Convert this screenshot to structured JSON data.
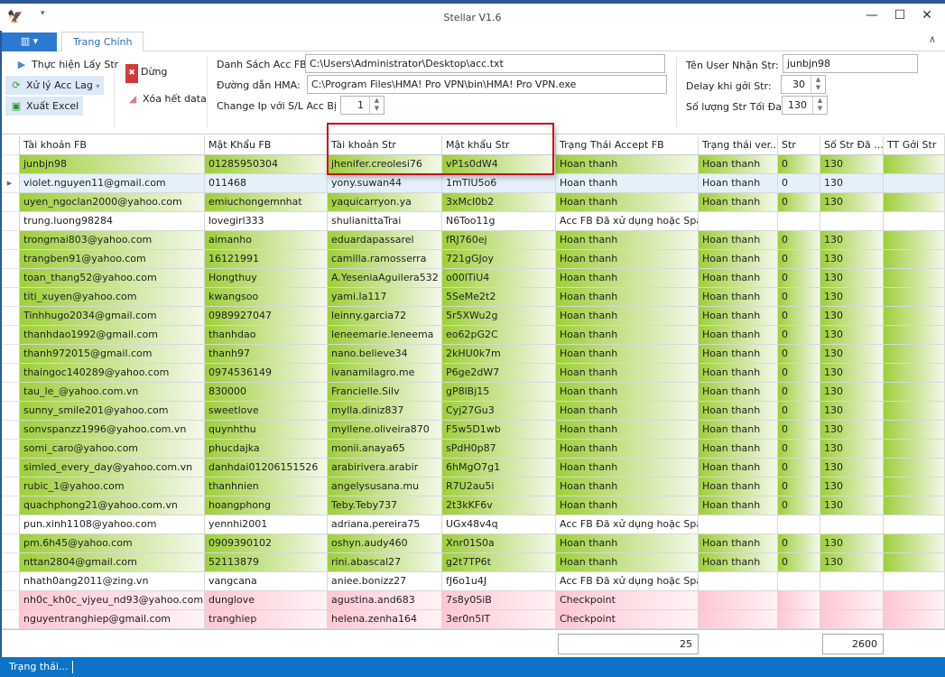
{
  "window": {
    "title": "Stellar V1.6",
    "minimize": "—",
    "maximize": "☐",
    "close": "✕",
    "accent": "#0c73c7"
  },
  "tabs": {
    "app_menu": "▥ ▾",
    "active": "Trang Chính",
    "collapse": "∧"
  },
  "ribbon": {
    "run": "Thực hiện Lấy Str",
    "lag": "Xử lý Acc Lag",
    "export": "Xuất Excel",
    "stop": "Dừng",
    "clear": "Xóa hết data",
    "acc_list_label": "Danh Sách Acc FB:",
    "acc_list_value": "C:\\Users\\Administrator\\Desktop\\acc.txt",
    "hma_label": "Đường dẫn HMA:",
    "hma_value": "C:\\Program Files\\HMA! Pro VPN\\bin\\HMA! Pro VPN.exe",
    "changeip_label": "Change Ip với S/L Acc Bị Lỗi",
    "changeip_value": "1",
    "user_label": "Tên User Nhận Str:",
    "user_value": "junbjn98",
    "delay_label": "Delay khi gởi Str:",
    "delay_value": "30",
    "max_label": "Số lượng Str Tối Đa:",
    "max_value": "130"
  },
  "columns": [
    "Tài khoản FB",
    "Mật Khẩu FB",
    "Tài khoản Str",
    "Mật khẩu Str",
    "Trạng Thái Accept FB",
    "Trạng thái ver...",
    "Str",
    "Số Str Đã ...",
    "TT Gởi Str"
  ],
  "rows": [
    {
      "state": "g",
      "cells": [
        "junbjn98",
        "01285950304",
        "jhenifer.creolesi76",
        "vP1s0dW4",
        "Hoan thanh",
        "Hoan thanh",
        "0",
        "130",
        ""
      ]
    },
    {
      "state": "s",
      "selected": true,
      "cells": [
        "violet.nguyen11@gmail.com",
        "011468",
        "yony.suwan44",
        "1mTlU5o6",
        "Hoan thanh",
        "Hoan thanh",
        "0",
        "130",
        ""
      ]
    },
    {
      "state": "g",
      "cells": [
        "uyen_ngoclan2000@yahoo.com",
        "emiuchongemnhat",
        "yaquicarryon.ya",
        "3xMcI0b2",
        "Hoan thanh",
        "Hoan thanh",
        "0",
        "130",
        ""
      ]
    },
    {
      "state": "w",
      "cells": [
        "trung.luong98284",
        "lovegirl333",
        "shulianittaTrai",
        "N6Too11g",
        "Acc FB Đã xử dụng hoặc Spam",
        "",
        "",
        "",
        ""
      ]
    },
    {
      "state": "g",
      "cells": [
        "trongmai803@yahoo.com",
        "aimanho",
        "eduardapassarel",
        "fRJ760ej",
        "Hoan thanh",
        "Hoan thanh",
        "0",
        "130",
        ""
      ]
    },
    {
      "state": "g",
      "cells": [
        "trangben91@yahoo.com",
        "16121991",
        "camilla.ramosserra",
        "721gGJoy",
        "Hoan thanh",
        "Hoan thanh",
        "0",
        "130",
        ""
      ]
    },
    {
      "state": "g",
      "cells": [
        "toan_thang52@yahoo.com",
        "Hongthuy",
        "A.YeseniaAguilera532",
        "o00lTiU4",
        "Hoan thanh",
        "Hoan thanh",
        "0",
        "130",
        ""
      ]
    },
    {
      "state": "g",
      "cells": [
        "titi_xuyen@yahoo.com",
        "kwangsoo",
        "yami.la117",
        "5SeMe2t2",
        "Hoan thanh",
        "Hoan thanh",
        "0",
        "130",
        ""
      ]
    },
    {
      "state": "g",
      "cells": [
        "Tinhhugo2034@gmail.com",
        "0989927047",
        "leinny.garcia72",
        "5r5XWu2g",
        "Hoan thanh",
        "Hoan thanh",
        "0",
        "130",
        ""
      ]
    },
    {
      "state": "g",
      "cells": [
        "thanhdao1992@gmail.com",
        "thanhdao",
        "leneemarie.leneema",
        "eo62pG2C",
        "Hoan thanh",
        "Hoan thanh",
        "0",
        "130",
        ""
      ]
    },
    {
      "state": "g",
      "cells": [
        "thanh972015@gmail.com",
        "thanh97",
        "nano.believe34",
        "2kHU0k7m",
        "Hoan thanh",
        "Hoan thanh",
        "0",
        "130",
        ""
      ]
    },
    {
      "state": "g",
      "cells": [
        "thaingoc140289@yahoo.com",
        "0974536149",
        "ivanamilagro.me",
        "P6ge2dW7",
        "Hoan thanh",
        "Hoan thanh",
        "0",
        "130",
        ""
      ]
    },
    {
      "state": "g",
      "cells": [
        "tau_le_@yahoo.com.vn",
        "830000",
        "Francielle.Silv",
        "gP8lBj15",
        "Hoan thanh",
        "Hoan thanh",
        "0",
        "130",
        ""
      ]
    },
    {
      "state": "g",
      "cells": [
        "sunny_smile201@yahoo.com",
        "sweetlove",
        "mylla.diniz837",
        "Cyj27Gu3",
        "Hoan thanh",
        "Hoan thanh",
        "0",
        "130",
        ""
      ]
    },
    {
      "state": "g",
      "cells": [
        "sonvspanzz1996@yahoo.com.vn",
        "quynhthu",
        "myllene.oliveira870",
        "F5w5D1wb",
        "Hoan thanh",
        "Hoan thanh",
        "0",
        "130",
        ""
      ]
    },
    {
      "state": "g",
      "cells": [
        "somi_caro@yahoo.com",
        "phucdajka",
        "monii.anaya65",
        "sPdH0p87",
        "Hoan thanh",
        "Hoan thanh",
        "0",
        "130",
        ""
      ]
    },
    {
      "state": "g",
      "cells": [
        "simled_every_day@yahoo.com.vn",
        "danhdai01206151526",
        "arabirivera.arabir",
        "6hMgO7g1",
        "Hoan thanh",
        "Hoan thanh",
        "0",
        "130",
        ""
      ]
    },
    {
      "state": "g",
      "cells": [
        "rubic_1@yahoo.com",
        "thanhnien",
        "angelysusana.mu",
        "R7U2au5i",
        "Hoan thanh",
        "Hoan thanh",
        "0",
        "130",
        ""
      ]
    },
    {
      "state": "g",
      "cells": [
        "quachphong21@yahoo.com.vn",
        "hoangphong",
        "Teby.Teby737",
        "2t3kKF6v",
        "Hoan thanh",
        "Hoan thanh",
        "0",
        "130",
        ""
      ]
    },
    {
      "state": "w",
      "cells": [
        "pun.xinh1108@yahoo.com",
        "yennhi2001",
        "adriana.pereira75",
        "UGx48v4q",
        "Acc FB Đã xử dụng hoặc Spam",
        "",
        "",
        "",
        ""
      ]
    },
    {
      "state": "g",
      "cells": [
        "pm.6h45@yahoo.com",
        "0909390102",
        "oshyn.audy460",
        "Xnr01S0a",
        "Hoan thanh",
        "Hoan thanh",
        "0",
        "130",
        ""
      ]
    },
    {
      "state": "g",
      "cells": [
        "nttan2804@gmail.com",
        "52113879",
        "rini.abascal27",
        "g2t7TP6t",
        "Hoan thanh",
        "Hoan thanh",
        "0",
        "130",
        ""
      ]
    },
    {
      "state": "w",
      "cells": [
        "nhath0ang2011@zing.vn",
        "vangcana",
        "aniee.bonizz27",
        "fJ6o1u4J",
        "Acc FB Đã xử dụng hoặc Spam",
        "",
        "",
        "",
        ""
      ]
    },
    {
      "state": "p",
      "cells": [
        "nh0c_kh0c_vjyeu_nd93@yahoo.com",
        "dunglove",
        "agustina.and683",
        "7s8y0SiB",
        "Checkpoint",
        "",
        "",
        "",
        ""
      ]
    },
    {
      "state": "p",
      "cells": [
        "nguyentranghiep@gmail.com",
        "tranghiep",
        "helena.zenha164",
        "3er0n5IT",
        "Checkpoint",
        "",
        "",
        "",
        ""
      ]
    }
  ],
  "footer": {
    "total_accept": "25",
    "total_str": "2600"
  },
  "status": {
    "text": "Trạng thái..."
  }
}
